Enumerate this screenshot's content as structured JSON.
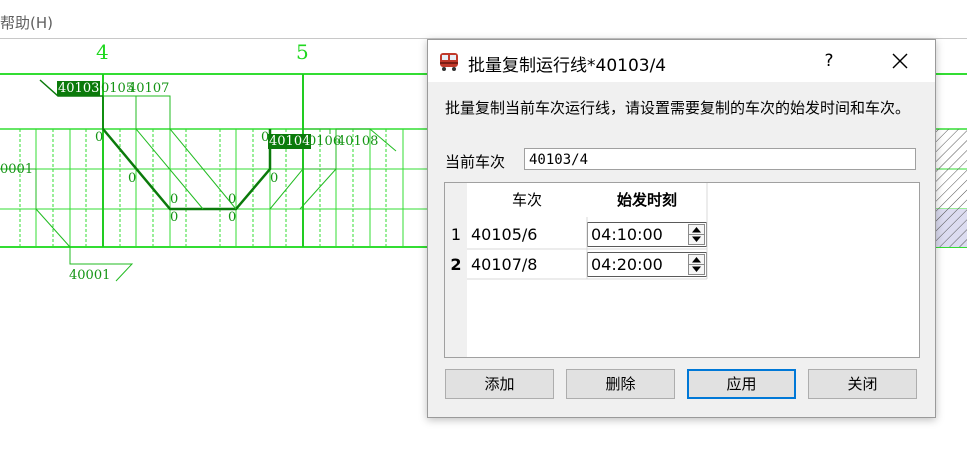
{
  "menubar": {
    "help_label": "帮助(H)"
  },
  "graph": {
    "hour_labels": [
      "4",
      "5"
    ],
    "train_labels": {
      "t40103": "40103",
      "t0105": "0105",
      "t40107": "40107",
      "t40104": "40104",
      "t0106": "0106",
      "t40108": "40108",
      "t0001_left": "0001",
      "t40001": "40001"
    },
    "digits": [
      "0",
      "0",
      "0",
      "0",
      "0",
      "0",
      "0",
      "0"
    ],
    "colors": {
      "grid": "#33dd33",
      "line": "#0b7a0b",
      "highlight": "#0b7a0b"
    }
  },
  "dialog": {
    "title": "批量复制运行线*40103/4",
    "help_symbol": "?",
    "description": "批量复制当前车次运行线，请设置需要复制的车次的始发时间和车次。",
    "current_train_label": "当前车次",
    "current_train_value": "40103/4",
    "table": {
      "headers": [
        "车次",
        "始发时刻"
      ],
      "rows": [
        {
          "index": "1",
          "train": "40105/6",
          "time": "04:10:00"
        },
        {
          "index": "2",
          "train": "40107/8",
          "time": "04:20:00"
        }
      ]
    },
    "buttons": {
      "add": "添加",
      "delete": "删除",
      "apply": "应用",
      "close": "关闭"
    }
  }
}
